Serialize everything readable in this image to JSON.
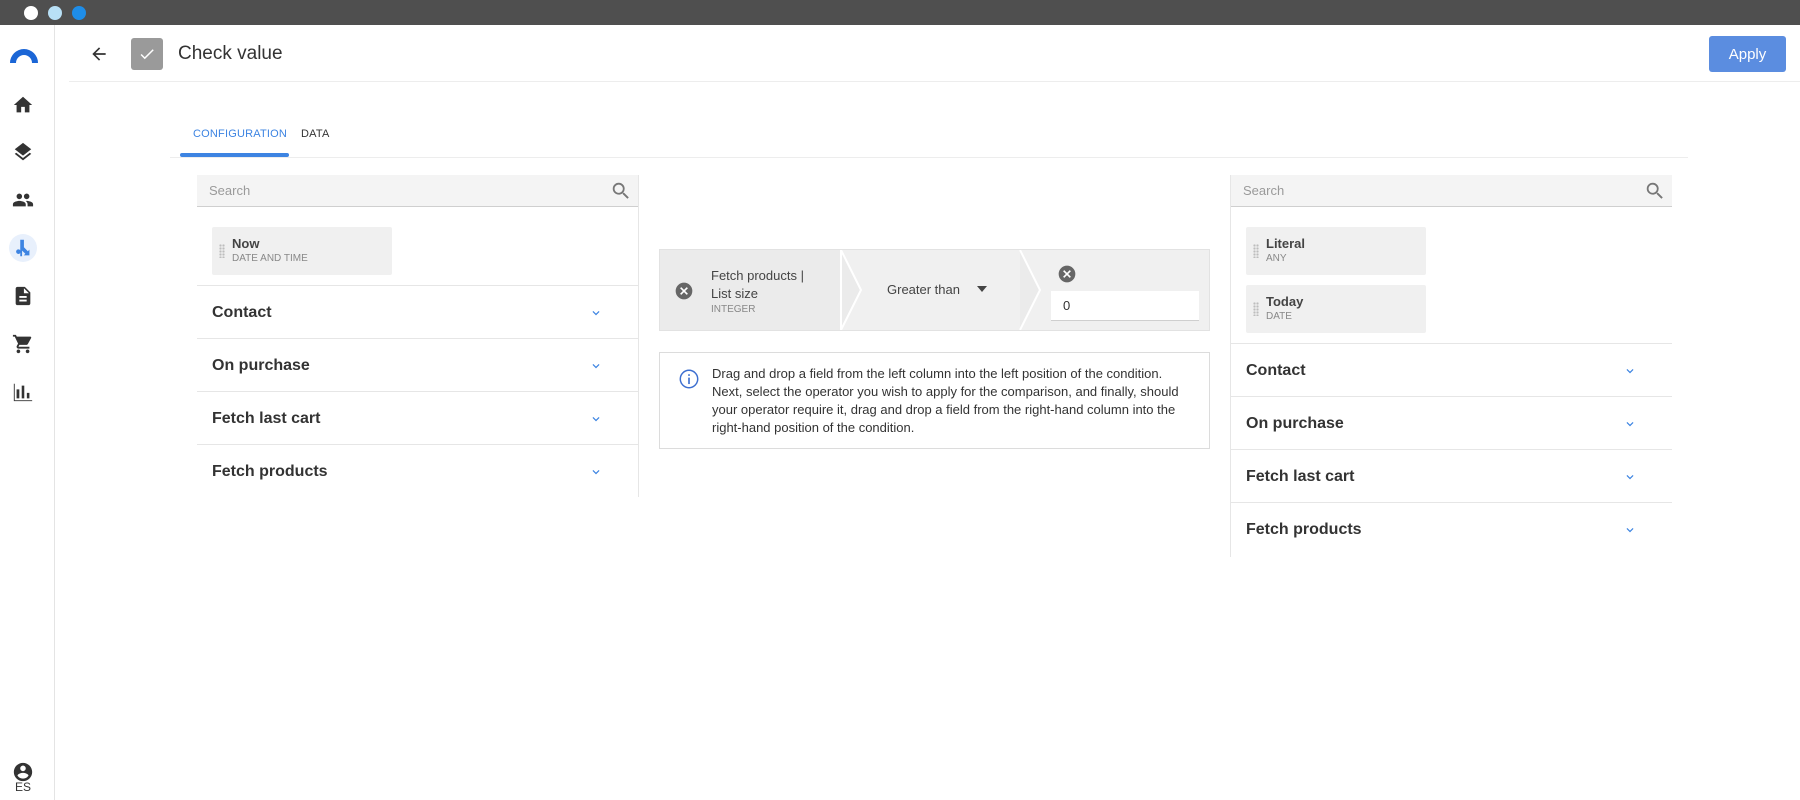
{
  "header": {
    "title": "Check value",
    "apply_label": "Apply"
  },
  "user": {
    "language": "ES"
  },
  "tabs": [
    {
      "label": "CONFIGURATION",
      "active": true
    },
    {
      "label": "DATA",
      "active": false
    }
  ],
  "left_column": {
    "search_placeholder": "Search",
    "chips": [
      {
        "name": "Now",
        "type": "DATE AND TIME"
      }
    ],
    "groups": [
      "Contact",
      "On purchase",
      "Fetch last cart",
      "Fetch products"
    ]
  },
  "right_column": {
    "search_placeholder": "Search",
    "chips": [
      {
        "name": "Literal",
        "type": "ANY"
      },
      {
        "name": "Today",
        "type": "DATE"
      }
    ],
    "groups": [
      "Contact",
      "On purchase",
      "Fetch last cart",
      "Fetch products"
    ]
  },
  "condition": {
    "left_field": "Fetch products | List size",
    "left_type": "INTEGER",
    "operator": "Greater than",
    "right_value": "0"
  },
  "info": {
    "text": "Drag and drop a field from the left column into the left position of the condition. Next, select the operator you wish to apply for the comparison, and finally, should your operator require it, drag and drop a field from the right-hand column into the right-hand position of the condition."
  },
  "colors": {
    "accent": "#3d84e2",
    "apply_button": "#5b8de0",
    "title_bar": "#4f4f4f"
  },
  "icons": {
    "nav": [
      "logo-icon",
      "home-icon",
      "layers-icon",
      "people-icon",
      "flow-icon",
      "document-icon",
      "cart-icon",
      "chart-icon",
      "account-icon"
    ]
  }
}
